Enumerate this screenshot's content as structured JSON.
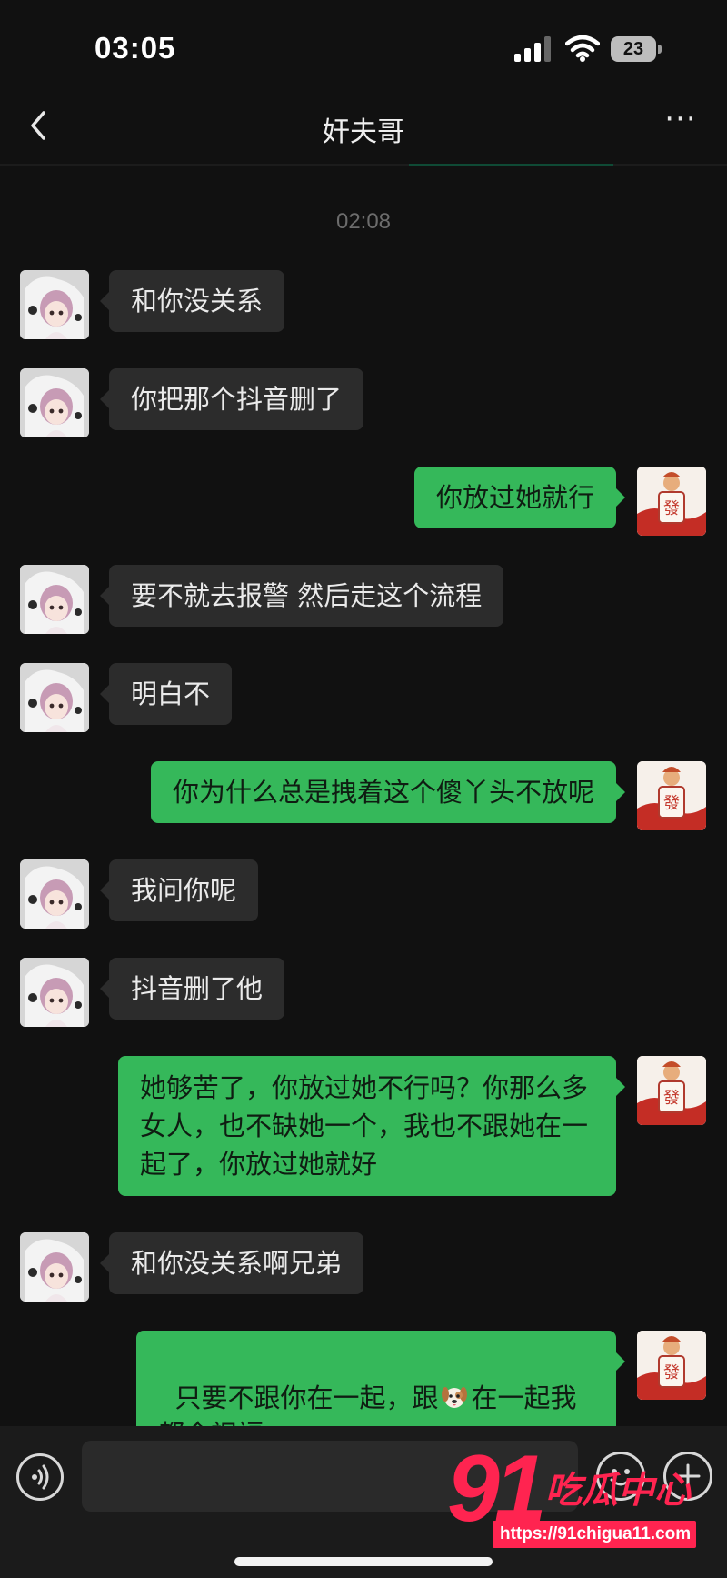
{
  "status_bar": {
    "time": "03:05",
    "battery": "23"
  },
  "header": {
    "title": "奸夫哥",
    "more_label": "···"
  },
  "conversation": {
    "timestamp": "02:08",
    "messages": [
      {
        "side": "in",
        "text": "和你没关系"
      },
      {
        "side": "in",
        "text": "你把那个抖音删了"
      },
      {
        "side": "out",
        "text": "你放过她就行"
      },
      {
        "side": "in",
        "text": "要不就去报警 然后走这个流程"
      },
      {
        "side": "in",
        "text": "明白不"
      },
      {
        "side": "out",
        "text": "你为什么总是拽着这个傻丫头不放呢"
      },
      {
        "side": "in",
        "text": "我问你呢"
      },
      {
        "side": "in",
        "text": "抖音删了他"
      },
      {
        "side": "out",
        "text": "她够苦了，你放过她不行吗？你那么多女人，也不缺她一个，我也不跟她在一起了，你放过她就好"
      },
      {
        "side": "in",
        "text": "和你没关系啊兄弟"
      },
      {
        "side": "out",
        "text_before": "只要不跟你在一起，跟",
        "emoji": "dog-face-emoji",
        "text_after": "在一起我都会祝福。"
      }
    ]
  },
  "input_bar": {
    "placeholder": ""
  },
  "avatars": {
    "contact": "illustrated-girl-avatar",
    "self": "fa-mahjong-avatar"
  },
  "watermark": {
    "number": "91",
    "name": "吃瓜中心",
    "url": "https://91chigua11.com"
  },
  "colors": {
    "background": "#111111",
    "bubble_in": "#2c2c2c",
    "bubble_out": "#35b85a",
    "watermark": "#ff2450"
  }
}
